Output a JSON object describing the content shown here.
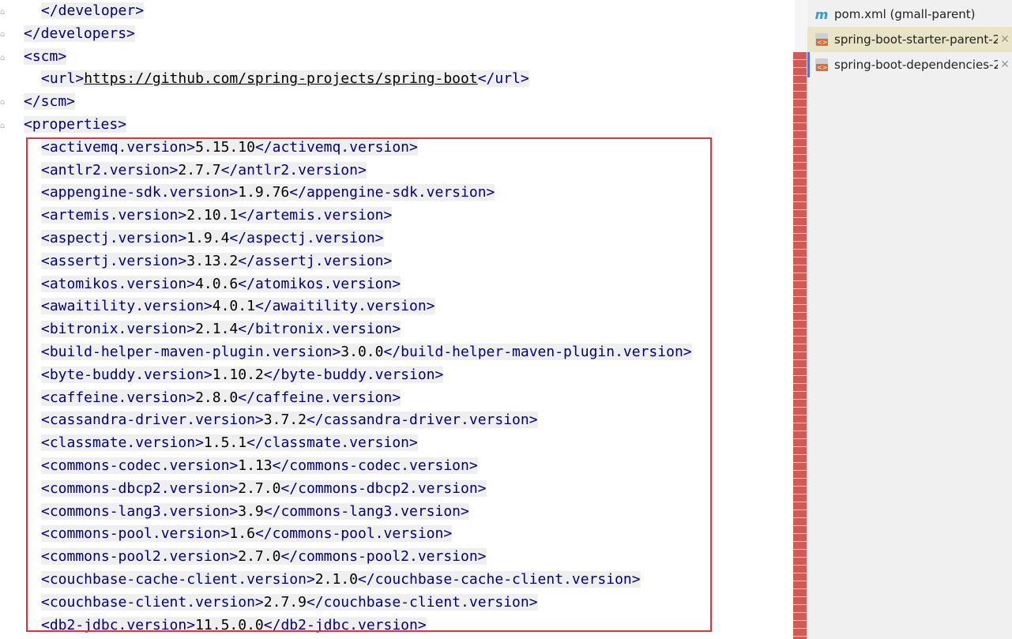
{
  "editor": {
    "lines": [
      {
        "indent": 1,
        "open": "</developer>",
        "value": "",
        "close": ""
      },
      {
        "indent": 0,
        "open": "</developers>",
        "value": "",
        "close": ""
      },
      {
        "indent": 0,
        "open": "<scm>",
        "value": "",
        "close": ""
      },
      {
        "indent": 1,
        "open": "<url>",
        "value": "https://github.com/spring-projects/spring-boot",
        "close": "</url>",
        "is_url": true
      },
      {
        "indent": 0,
        "open": "</scm>",
        "value": "",
        "close": ""
      },
      {
        "indent": 0,
        "open": "<properties>",
        "value": "",
        "close": ""
      },
      {
        "indent": 1,
        "open": "<activemq.version>",
        "value": "5.15.10",
        "close": "</activemq.version>"
      },
      {
        "indent": 1,
        "open": "<antlr2.version>",
        "value": "2.7.7",
        "close": "</antlr2.version>"
      },
      {
        "indent": 1,
        "open": "<appengine-sdk.version>",
        "value": "1.9.76",
        "close": "</appengine-sdk.version>"
      },
      {
        "indent": 1,
        "open": "<artemis.version>",
        "value": "2.10.1",
        "close": "</artemis.version>"
      },
      {
        "indent": 1,
        "open": "<aspectj.version>",
        "value": "1.9.4",
        "close": "</aspectj.version>"
      },
      {
        "indent": 1,
        "open": "<assertj.version>",
        "value": "3.13.2",
        "close": "</assertj.version>"
      },
      {
        "indent": 1,
        "open": "<atomikos.version>",
        "value": "4.0.6",
        "close": "</atomikos.version>"
      },
      {
        "indent": 1,
        "open": "<awaitility.version>",
        "value": "4.0.1",
        "close": "</awaitility.version>"
      },
      {
        "indent": 1,
        "open": "<bitronix.version>",
        "value": "2.1.4",
        "close": "</bitronix.version>"
      },
      {
        "indent": 1,
        "open": "<build-helper-maven-plugin.version>",
        "value": "3.0.0",
        "close": "</build-helper-maven-plugin.version>"
      },
      {
        "indent": 1,
        "open": "<byte-buddy.version>",
        "value": "1.10.2",
        "close": "</byte-buddy.version>"
      },
      {
        "indent": 1,
        "open": "<caffeine.version>",
        "value": "2.8.0",
        "close": "</caffeine.version>"
      },
      {
        "indent": 1,
        "open": "<cassandra-driver.version>",
        "value": "3.7.2",
        "close": "</cassandra-driver.version>"
      },
      {
        "indent": 1,
        "open": "<classmate.version>",
        "value": "1.5.1",
        "close": "</classmate.version>"
      },
      {
        "indent": 1,
        "open": "<commons-codec.version>",
        "value": "1.13",
        "close": "</commons-codec.version>"
      },
      {
        "indent": 1,
        "open": "<commons-dbcp2.version>",
        "value": "2.7.0",
        "close": "</commons-dbcp2.version>"
      },
      {
        "indent": 1,
        "open": "<commons-lang3.version>",
        "value": "3.9",
        "close": "</commons-lang3.version>"
      },
      {
        "indent": 1,
        "open": "<commons-pool.version>",
        "value": "1.6",
        "close": "</commons-pool.version>"
      },
      {
        "indent": 1,
        "open": "<commons-pool2.version>",
        "value": "2.7.0",
        "close": "</commons-pool2.version>"
      },
      {
        "indent": 1,
        "open": "<couchbase-cache-client.version>",
        "value": "2.1.0",
        "close": "</couchbase-cache-client.version>"
      },
      {
        "indent": 1,
        "open": "<couchbase-client.version>",
        "value": "2.7.9",
        "close": "</couchbase-client.version>"
      },
      {
        "indent": 1,
        "open": "<db2-jdbc.version>",
        "value": "11.5.0.0",
        "close": "</db2-jdbc.version>"
      }
    ]
  },
  "panel": {
    "tabs": [
      {
        "label": "pom.xml (gmall-parent)",
        "icon": "maven-m-icon",
        "closable": false,
        "active": false
      },
      {
        "label": "spring-boot-starter-parent-2",
        "icon": "xml-file-icon",
        "closable": true,
        "active": true
      },
      {
        "label": "spring-boot-dependencies-2",
        "icon": "xml-file-icon",
        "closable": true,
        "active": false
      }
    ],
    "close_glyph": "✕",
    "maven_glyph": "m"
  },
  "colors": {
    "tag": "#000080",
    "highlight_border": "#e0333a",
    "scroll_marker": "#d05a55",
    "active_tab": "#e8e4c6"
  }
}
